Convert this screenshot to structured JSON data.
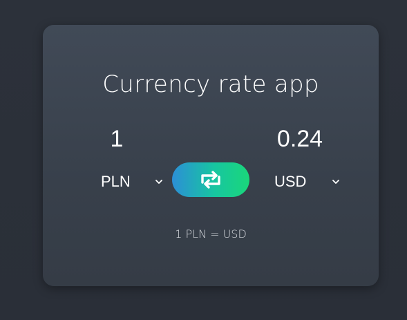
{
  "app": {
    "title": "Currency rate app"
  },
  "converter": {
    "from_amount": "1",
    "to_amount": "0.24",
    "from_currency": "PLN",
    "to_currency": "USD",
    "rate_text": "1 PLN = USD"
  },
  "icons": {
    "swap": "swap-arrows-icon",
    "dropdown": "chevron-down-icon"
  },
  "colors": {
    "background": "#2c313a",
    "card": "#3d4551",
    "swap_gradient_start": "#2c8fd6",
    "swap_gradient_end": "#1ad77a",
    "text": "#ffffff"
  }
}
